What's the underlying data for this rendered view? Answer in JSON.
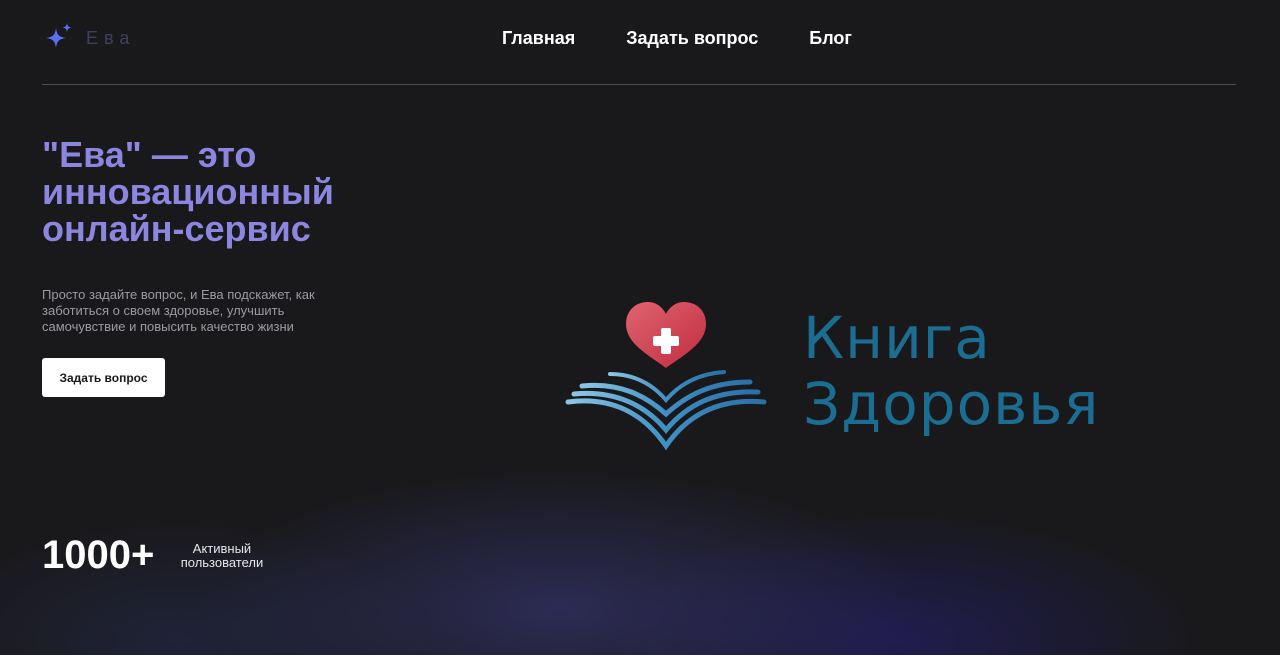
{
  "header": {
    "logo_text": "Ева",
    "logo_icon": "sparkle-icon",
    "nav": [
      {
        "label": "Главная"
      },
      {
        "label": "Задать вопрос"
      },
      {
        "label": "Блог"
      }
    ]
  },
  "hero": {
    "title": "\"Ева\" — это инновационный онлайн-сервис",
    "subtitle": "Просто задайте вопрос, и Ева подскажет, как заботиться о своем здоровье, улучшить самочувствие и повысить качество жизни",
    "cta_label": "Задать вопрос"
  },
  "brand": {
    "line1": "Книга",
    "line2": "Здоровья",
    "icon": "heart-book-icon"
  },
  "stats": {
    "value": "1000+",
    "label": "Активный пользователи"
  },
  "colors": {
    "accent": "#8c86e0",
    "logo_icon": "#5b6cf0",
    "brand_text": "#1b6e92",
    "heart": "#d2334a",
    "book": "#4aa3cf",
    "background": "#19191c"
  }
}
